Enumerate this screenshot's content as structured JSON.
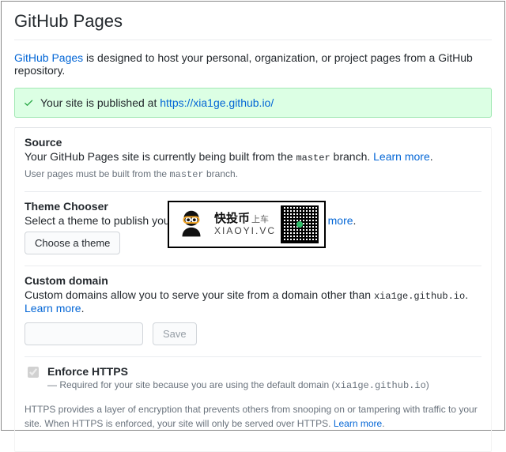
{
  "page": {
    "title": "GitHub Pages",
    "intro_link": "GitHub Pages",
    "intro_rest": " is designed to host your personal, organization, or project pages from a GitHub repository."
  },
  "flash": {
    "prefix": "Your site is published at ",
    "url": "https://xia1ge.github.io/"
  },
  "source": {
    "heading": "Source",
    "desc_pre": "Your GitHub Pages site is currently being built from the ",
    "branch": "master",
    "desc_post": " branch. ",
    "learn": "Learn more",
    "hint_pre": "User pages must be built from the ",
    "hint_branch": "master",
    "hint_post": " branch."
  },
  "theme": {
    "heading": "Theme Chooser",
    "desc": "Select a theme to publish your site with a Jekyll theme. ",
    "learn": "Learn more",
    "button": "Choose a theme"
  },
  "domain": {
    "heading": "Custom domain",
    "desc_pre": "Custom domains allow you to serve your site from a domain other than ",
    "default_domain": "xia1ge.github.io",
    "desc_post": ". ",
    "learn": "Learn more",
    "input_value": "",
    "save": "Save"
  },
  "https": {
    "label": "Enforce HTTPS",
    "sub_pre": "— Required for your site because you are using the default domain (",
    "sub_domain": "xia1ge.github.io",
    "sub_post": ")",
    "desc": "HTTPS provides a layer of encryption that prevents others from snooping on or tampering with traffic to your site. When HTTPS is enforced, your site will only be served over HTTPS. ",
    "learn": "Learn more",
    "checked": true
  },
  "watermark": {
    "line1_main": "快投币",
    "line1_small": "上车",
    "line2": "XIAOYI.VC"
  }
}
